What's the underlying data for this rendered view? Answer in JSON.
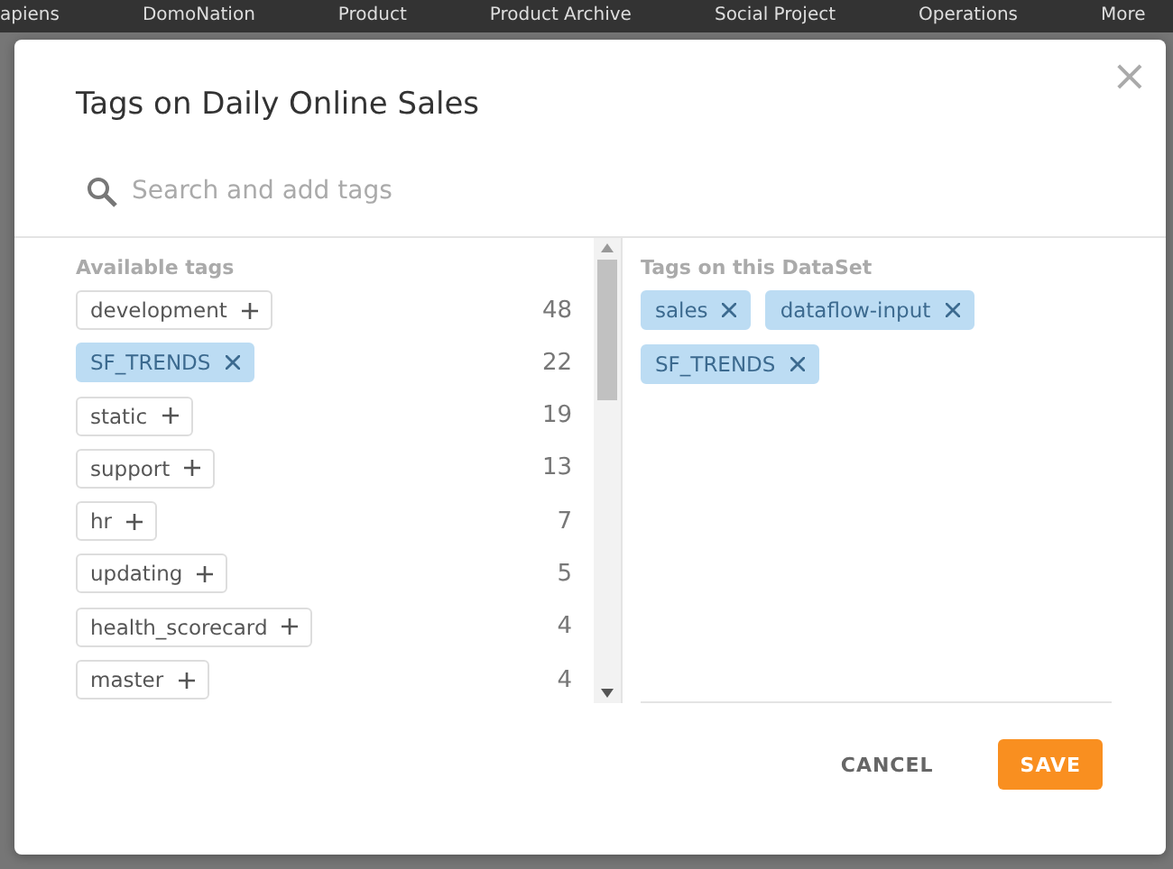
{
  "nav": [
    "apiens",
    "DomoNation",
    "Product",
    "Product Archive",
    "Social Project",
    "Operations",
    "More"
  ],
  "dialog": {
    "title": "Tags on Daily Online Sales",
    "close": "×",
    "search": {
      "placeholder": "Search and add tags"
    },
    "available": {
      "heading": "Available tags",
      "tags": [
        {
          "label": "development",
          "count": "48",
          "selected": false
        },
        {
          "label": "SF_TRENDS",
          "count": "22",
          "selected": true
        },
        {
          "label": "static",
          "count": "19",
          "selected": false
        },
        {
          "label": "support",
          "count": "13",
          "selected": false
        },
        {
          "label": "hr",
          "count": "7",
          "selected": false
        },
        {
          "label": "updating",
          "count": "5",
          "selected": false
        },
        {
          "label": "health_scorecard",
          "count": "4",
          "selected": false
        },
        {
          "label": "master",
          "count": "4",
          "selected": false
        }
      ]
    },
    "applied": {
      "heading": "Tags on this DataSet",
      "tags": [
        "sales",
        "dataflow-input",
        "SF_TRENDS"
      ]
    },
    "buttons": [
      {
        "label": "CANCEL",
        "kind": "secondary"
      },
      {
        "label": "SAVE",
        "kind": "primary"
      }
    ]
  }
}
